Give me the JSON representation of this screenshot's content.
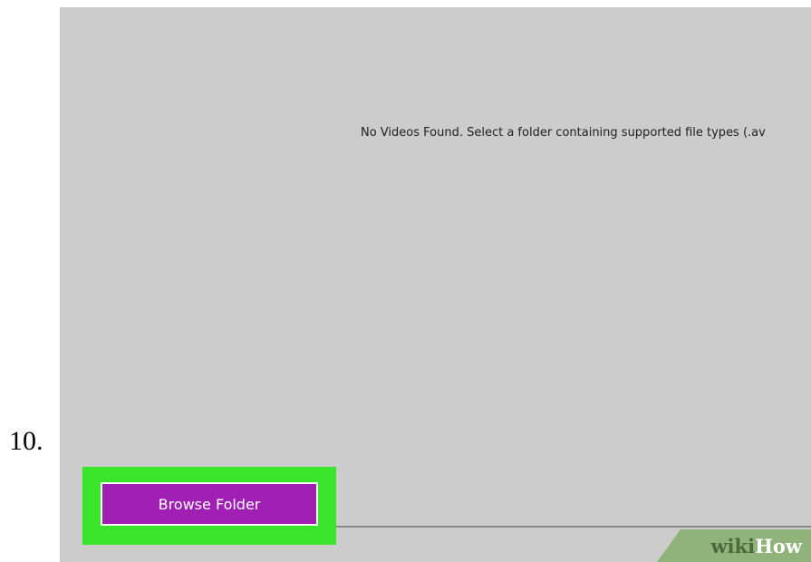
{
  "step": {
    "number_label": "10."
  },
  "main": {
    "empty_message": "No Videos Found. Select a folder containing supported file types (.av"
  },
  "toolbar": {
    "browse_label": "Browse Folder"
  },
  "watermark": {
    "part1": "wiki",
    "part2": "How"
  },
  "colors": {
    "panel_background": "#cccccc",
    "button_accent": "#a020b4",
    "highlight": "#39e62b",
    "watermark_green": "#8fb37a"
  }
}
